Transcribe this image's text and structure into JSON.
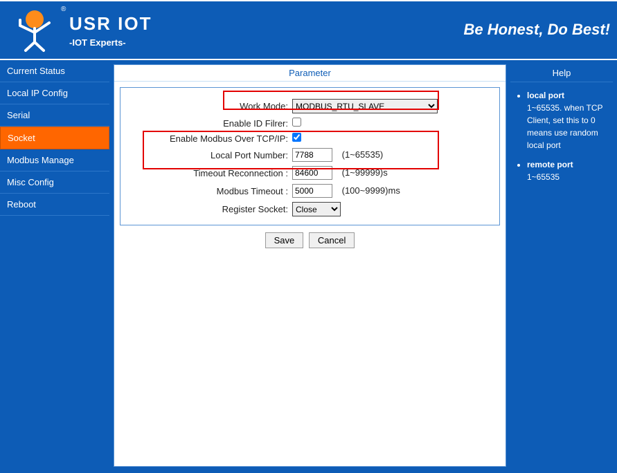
{
  "header": {
    "brand": "USR IOT",
    "subtitle": "-IOT Experts-",
    "slogan": "Be Honest, Do Best!",
    "reg": "®"
  },
  "sidebar": {
    "items": [
      {
        "label": "Current Status"
      },
      {
        "label": "Local IP Config"
      },
      {
        "label": "Serial"
      },
      {
        "label": "Socket"
      },
      {
        "label": "Modbus Manage"
      },
      {
        "label": "Misc Config"
      },
      {
        "label": "Reboot"
      }
    ],
    "active_index": 3
  },
  "panel": {
    "title": "Parameter",
    "work_mode_label": "Work Mode:",
    "work_mode_value": "MODBUS_RTU_SLAVE",
    "enable_id_filter_label": "Enable ID Filrer:",
    "enable_id_filter_checked": false,
    "enable_modbus_tcpip_label": "Enable Modbus Over TCP/IP:",
    "enable_modbus_tcpip_checked": true,
    "local_port_label": "Local Port Number:",
    "local_port_value": "7788",
    "local_port_hint": "(1~65535)",
    "timeout_reconn_label": "Timeout Reconnection :",
    "timeout_reconn_value": "84600",
    "timeout_reconn_hint": "(1~99999)s",
    "modbus_timeout_label": "Modbus Timeout :",
    "modbus_timeout_value": "5000",
    "modbus_timeout_hint": "(100~9999)ms",
    "register_socket_label": "Register Socket:",
    "register_socket_value": "Close",
    "save_label": "Save",
    "cancel_label": "Cancel"
  },
  "help": {
    "title": "Help",
    "items": [
      {
        "title": "local port",
        "text": "1~65535. when TCP Client, set this to 0 means use random local port"
      },
      {
        "title": "remote port",
        "text": "1~65535"
      }
    ]
  }
}
